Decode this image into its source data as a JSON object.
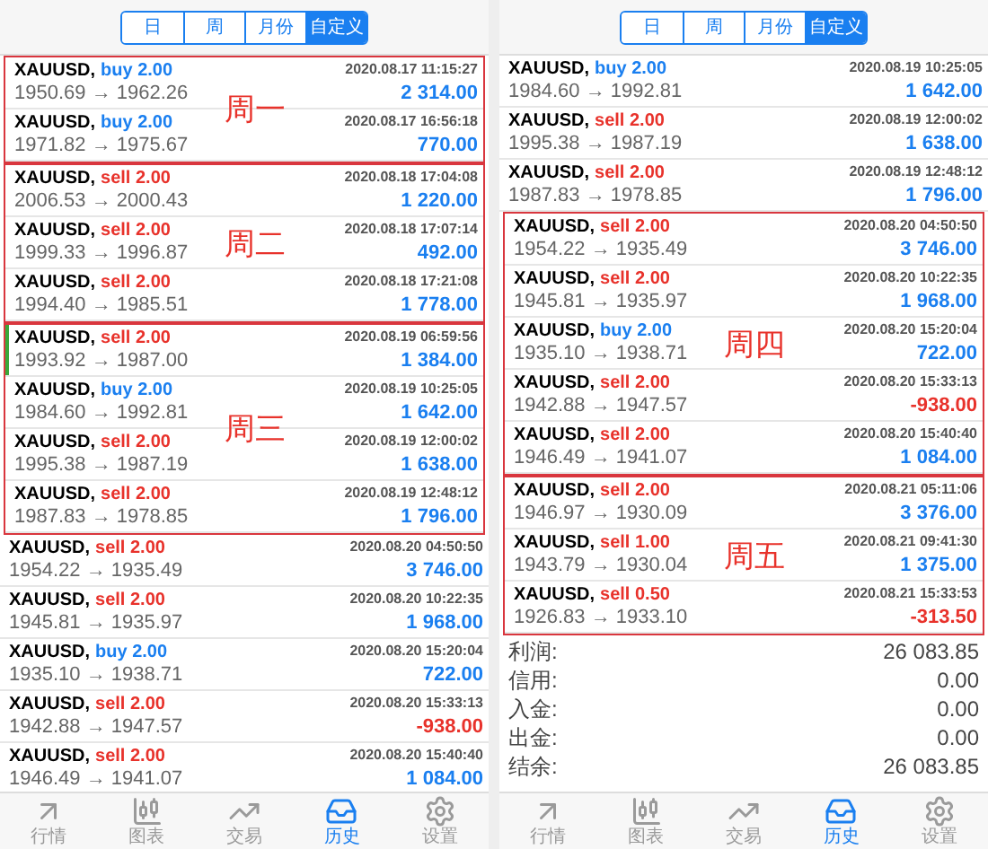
{
  "panels": [
    {
      "tabs": [
        {
          "label": "日",
          "selected": false
        },
        {
          "label": "周",
          "selected": false
        },
        {
          "label": "月份",
          "selected": false
        },
        {
          "label": "自定义",
          "selected": true
        }
      ],
      "sections": [
        {
          "boxed": true,
          "label": "周一",
          "deals": [
            {
              "symbol": "XAUUSD,",
              "side": "buy 2.00",
              "kind": "buy",
              "time": "2020.08.17 11:15:27",
              "prices": "1950.69 → 1962.26",
              "profit": "2 314.00",
              "loss": false,
              "marked": false
            },
            {
              "symbol": "XAUUSD,",
              "side": "buy 2.00",
              "kind": "buy",
              "time": "2020.08.17 16:56:18",
              "prices": "1971.82 → 1975.67",
              "profit": "770.00",
              "loss": false,
              "marked": false
            }
          ]
        },
        {
          "boxed": true,
          "label": "周二",
          "deals": [
            {
              "symbol": "XAUUSD,",
              "side": "sell 2.00",
              "kind": "sell",
              "time": "2020.08.18 17:04:08",
              "prices": "2006.53 → 2000.43",
              "profit": "1 220.00",
              "loss": false,
              "marked": false
            },
            {
              "symbol": "XAUUSD,",
              "side": "sell 2.00",
              "kind": "sell",
              "time": "2020.08.18 17:07:14",
              "prices": "1999.33 → 1996.87",
              "profit": "492.00",
              "loss": false,
              "marked": false
            },
            {
              "symbol": "XAUUSD,",
              "side": "sell 2.00",
              "kind": "sell",
              "time": "2020.08.18 17:21:08",
              "prices": "1994.40 → 1985.51",
              "profit": "1 778.00",
              "loss": false,
              "marked": false
            }
          ]
        },
        {
          "boxed": true,
          "label": "周三",
          "deals": [
            {
              "symbol": "XAUUSD,",
              "side": "sell 2.00",
              "kind": "sell",
              "time": "2020.08.19 06:59:56",
              "prices": "1993.92 → 1987.00",
              "profit": "1 384.00",
              "loss": false,
              "marked": true
            },
            {
              "symbol": "XAUUSD,",
              "side": "buy 2.00",
              "kind": "buy",
              "time": "2020.08.19 10:25:05",
              "prices": "1984.60 → 1992.81",
              "profit": "1 642.00",
              "loss": false,
              "marked": false
            },
            {
              "symbol": "XAUUSD,",
              "side": "sell 2.00",
              "kind": "sell",
              "time": "2020.08.19 12:00:02",
              "prices": "1995.38 → 1987.19",
              "profit": "1 638.00",
              "loss": false,
              "marked": false
            },
            {
              "symbol": "XAUUSD,",
              "side": "sell 2.00",
              "kind": "sell",
              "time": "2020.08.19 12:48:12",
              "prices": "1987.83 → 1978.85",
              "profit": "1 796.00",
              "loss": false,
              "marked": false
            }
          ]
        },
        {
          "boxed": false,
          "deals": [
            {
              "symbol": "XAUUSD,",
              "side": "sell 2.00",
              "kind": "sell",
              "time": "2020.08.20 04:50:50",
              "prices": "1954.22 → 1935.49",
              "profit": "3 746.00",
              "loss": false,
              "marked": false
            },
            {
              "symbol": "XAUUSD,",
              "side": "sell 2.00",
              "kind": "sell",
              "time": "2020.08.20 10:22:35",
              "prices": "1945.81 → 1935.97",
              "profit": "1 968.00",
              "loss": false,
              "marked": false
            },
            {
              "symbol": "XAUUSD,",
              "side": "buy 2.00",
              "kind": "buy",
              "time": "2020.08.20 15:20:04",
              "prices": "1935.10 → 1938.71",
              "profit": "722.00",
              "loss": false,
              "marked": false
            },
            {
              "symbol": "XAUUSD,",
              "side": "sell 2.00",
              "kind": "sell",
              "time": "2020.08.20 15:33:13",
              "prices": "1942.88 → 1947.57",
              "profit": "-938.00",
              "loss": true,
              "marked": false
            },
            {
              "symbol": "XAUUSD,",
              "side": "sell 2.00",
              "kind": "sell",
              "time": "2020.08.20 15:40:40",
              "prices": "1946.49 → 1941.07",
              "profit": "1 084.00",
              "loss": false,
              "marked": false
            }
          ]
        }
      ],
      "nav": [
        {
          "label": "行情",
          "kind": "quotes",
          "selected": false
        },
        {
          "label": "图表",
          "kind": "chart",
          "selected": false
        },
        {
          "label": "交易",
          "kind": "trade",
          "selected": false
        },
        {
          "label": "历史",
          "kind": "history",
          "selected": true
        },
        {
          "label": "设置",
          "kind": "settings",
          "selected": false
        }
      ]
    },
    {
      "tabs": [
        {
          "label": "日",
          "selected": false
        },
        {
          "label": "周",
          "selected": false
        },
        {
          "label": "月份",
          "selected": false
        },
        {
          "label": "自定义",
          "selected": true
        }
      ],
      "sections": [
        {
          "boxed": false,
          "deals": [
            {
              "symbol": "XAUUSD,",
              "side": "buy 2.00",
              "kind": "buy",
              "time": "2020.08.19 10:25:05",
              "prices": "1984.60 → 1992.81",
              "profit": "1 642.00",
              "loss": false,
              "marked": false
            },
            {
              "symbol": "XAUUSD,",
              "side": "sell 2.00",
              "kind": "sell",
              "time": "2020.08.19 12:00:02",
              "prices": "1995.38 → 1987.19",
              "profit": "1 638.00",
              "loss": false,
              "marked": false
            },
            {
              "symbol": "XAUUSD,",
              "side": "sell 2.00",
              "kind": "sell",
              "time": "2020.08.19 12:48:12",
              "prices": "1987.83 → 1978.85",
              "profit": "1 796.00",
              "loss": false,
              "marked": false
            }
          ]
        },
        {
          "boxed": true,
          "label": "周四",
          "deals": [
            {
              "symbol": "XAUUSD,",
              "side": "sell 2.00",
              "kind": "sell",
              "time": "2020.08.20 04:50:50",
              "prices": "1954.22 → 1935.49",
              "profit": "3 746.00",
              "loss": false,
              "marked": false
            },
            {
              "symbol": "XAUUSD,",
              "side": "sell 2.00",
              "kind": "sell",
              "time": "2020.08.20 10:22:35",
              "prices": "1945.81 → 1935.97",
              "profit": "1 968.00",
              "loss": false,
              "marked": false
            },
            {
              "symbol": "XAUUSD,",
              "side": "buy 2.00",
              "kind": "buy",
              "time": "2020.08.20 15:20:04",
              "prices": "1935.10 → 1938.71",
              "profit": "722.00",
              "loss": false,
              "marked": false
            },
            {
              "symbol": "XAUUSD,",
              "side": "sell 2.00",
              "kind": "sell",
              "time": "2020.08.20 15:33:13",
              "prices": "1942.88 → 1947.57",
              "profit": "-938.00",
              "loss": true,
              "marked": false
            },
            {
              "symbol": "XAUUSD,",
              "side": "sell 2.00",
              "kind": "sell",
              "time": "2020.08.20 15:40:40",
              "prices": "1946.49 → 1941.07",
              "profit": "1 084.00",
              "loss": false,
              "marked": false
            }
          ]
        },
        {
          "boxed": true,
          "label": "周五",
          "deals": [
            {
              "symbol": "XAUUSD,",
              "side": "sell 2.00",
              "kind": "sell",
              "time": "2020.08.21 05:11:06",
              "prices": "1946.97 → 1930.09",
              "profit": "3 376.00",
              "loss": false,
              "marked": false
            },
            {
              "symbol": "XAUUSD,",
              "side": "sell 1.00",
              "kind": "sell",
              "time": "2020.08.21 09:41:30",
              "prices": "1943.79 → 1930.04",
              "profit": "1 375.00",
              "loss": false,
              "marked": false
            },
            {
              "symbol": "XAUUSD,",
              "side": "sell 0.50",
              "kind": "sell",
              "time": "2020.08.21 15:33:53",
              "prices": "1926.83 → 1933.10",
              "profit": "-313.50",
              "loss": true,
              "marked": false
            }
          ]
        }
      ],
      "summary": [
        {
          "label": "利润:",
          "value": "26 083.85"
        },
        {
          "label": "信用:",
          "value": "0.00"
        },
        {
          "label": "入金:",
          "value": "0.00"
        },
        {
          "label": "出金:",
          "value": "0.00"
        },
        {
          "label": "结余:",
          "value": "26 083.85"
        }
      ],
      "nav": [
        {
          "label": "行情",
          "kind": "quotes",
          "selected": false
        },
        {
          "label": "图表",
          "kind": "chart",
          "selected": false
        },
        {
          "label": "交易",
          "kind": "trade",
          "selected": false
        },
        {
          "label": "历史",
          "kind": "history",
          "selected": true
        },
        {
          "label": "设置",
          "kind": "settings",
          "selected": false
        }
      ]
    }
  ]
}
